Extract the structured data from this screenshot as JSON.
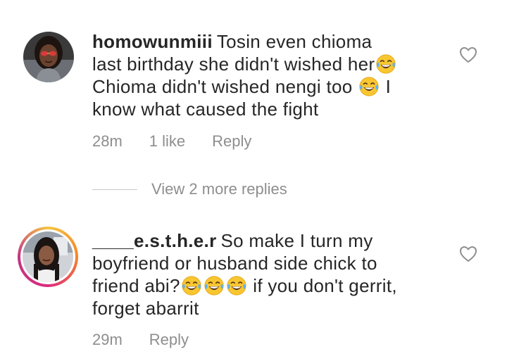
{
  "comments": [
    {
      "username": "homowunmiii",
      "text_lines": [
        "Tosin even chioma",
        "last birthday she didn't wished her",
        "Chioma didn't wished nengi too",
        "I",
        "know what caused the fight"
      ],
      "time": "28m",
      "likes": "1 like",
      "reply": "Reply"
    },
    {
      "username": "____e.s.t.h.e.r",
      "text_lines": [
        "So make I turn my",
        "boyfriend or husband side chick to",
        "friend abi?",
        "if you don't gerrit,",
        "forget abarrit"
      ],
      "time": "29m",
      "reply": "Reply"
    }
  ],
  "view_replies": "View 2 more replies",
  "icons": {
    "heart": "heart-outline-icon",
    "emoji": "face-with-tears-of-joy-icon"
  },
  "colors": {
    "text": "#262626",
    "muted": "#8e8e8e",
    "story_ring": [
      "#f5c542",
      "#f58529",
      "#dd2a7b",
      "#c13584"
    ]
  }
}
